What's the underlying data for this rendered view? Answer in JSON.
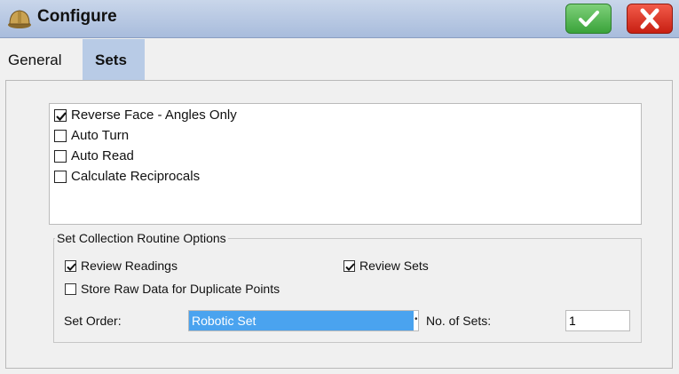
{
  "window": {
    "title": "Configure",
    "icon": "hard-hat-icon",
    "ok_icon": "checkmark-icon",
    "cancel_icon": "close-x-icon",
    "colors": {
      "ok": "#3aa33a",
      "cancel": "#c81f12",
      "titlebar": "#b4c6e2"
    }
  },
  "tabs": [
    {
      "label": "General",
      "active": false
    },
    {
      "label": "Sets",
      "active": true
    }
  ],
  "list_options": [
    {
      "label": "Reverse Face - Angles Only",
      "checked": true
    },
    {
      "label": "Auto Turn",
      "checked": false
    },
    {
      "label": "Auto Read",
      "checked": false
    },
    {
      "label": "Calculate Reciprocals",
      "checked": false
    }
  ],
  "routine_options": {
    "title": "Set Collection Routine Options",
    "review_readings": {
      "label": "Review Readings",
      "checked": true
    },
    "review_sets": {
      "label": "Review Sets",
      "checked": true
    },
    "store_raw": {
      "label": "Store Raw Data for Duplicate Points",
      "checked": false
    },
    "set_order": {
      "label": "Set Order:",
      "value": "Robotic Set"
    },
    "num_sets": {
      "label": "No. of Sets:",
      "value": "1"
    }
  },
  "selection_color": "#4aa3ef"
}
